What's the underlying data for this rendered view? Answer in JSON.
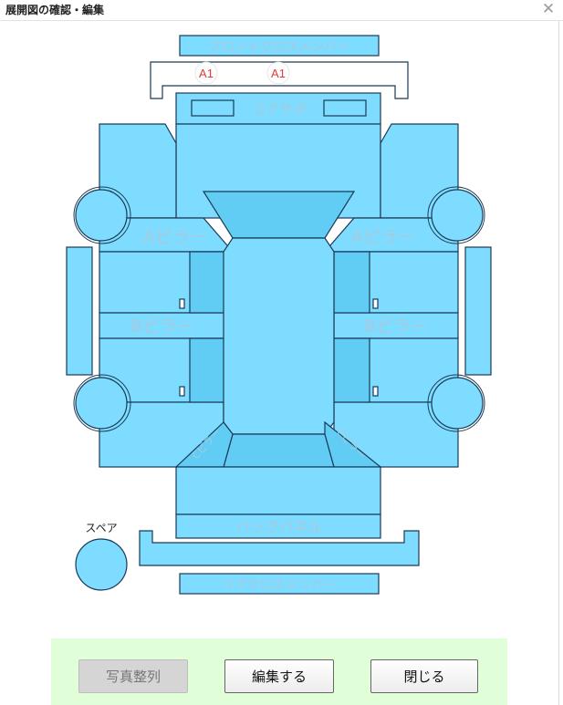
{
  "window": {
    "title": "展開図の確認・編集",
    "close_glyph": "✕"
  },
  "parts": {
    "front_cross_member": "フロントクロスメンバー",
    "core_support": "コアサポ",
    "a_pillar": "Aピラー",
    "b_pillar": "Bピラー",
    "c_pillar": "Cピラー",
    "back_panel": "バックパネル",
    "rear_cross_member": "リアクロスメンバー",
    "spare": "スペア"
  },
  "markers": [
    {
      "label": "A1"
    },
    {
      "label": "A1"
    }
  ],
  "footer": {
    "sort_photos": "写真整列",
    "edit": "編集する",
    "close": "閉じる"
  },
  "colors": {
    "panel": "#7ddcff",
    "panel_dark": "#61cdf5",
    "label": "#a9c9dc",
    "marker": "#e53935",
    "footer_bg": "#e0ffd9"
  }
}
